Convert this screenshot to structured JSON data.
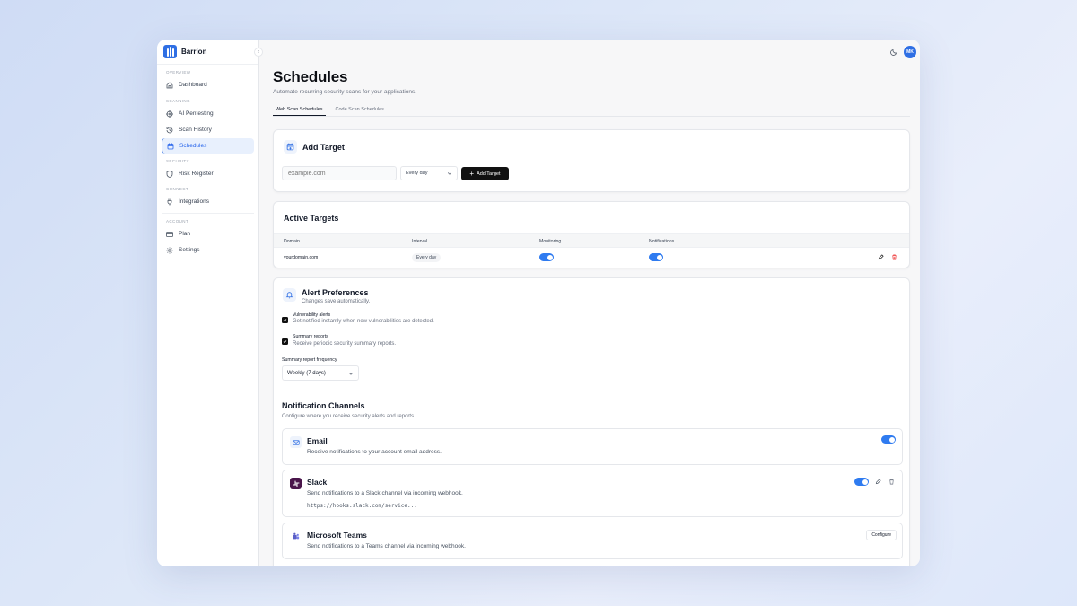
{
  "app": {
    "name": "Barrion",
    "user_initials": "MK"
  },
  "sidebar": {
    "sections": [
      {
        "label": "OVERVIEW",
        "items": [
          {
            "label": "Dashboard",
            "icon": "home-icon"
          }
        ]
      },
      {
        "label": "SCANNING",
        "items": [
          {
            "label": "AI Pentesting",
            "icon": "target-icon"
          },
          {
            "label": "Scan History",
            "icon": "history-icon"
          },
          {
            "label": "Schedules",
            "icon": "calendar-icon",
            "active": true
          }
        ]
      },
      {
        "label": "SECURITY",
        "items": [
          {
            "label": "Risk Register",
            "icon": "shield-icon"
          }
        ]
      },
      {
        "label": "CONNECT",
        "items": [
          {
            "label": "Integrations",
            "icon": "plug-icon"
          }
        ]
      },
      {
        "label": "ACCOUNT",
        "items": [
          {
            "label": "Plan",
            "icon": "card-icon"
          },
          {
            "label": "Settings",
            "icon": "gear-icon"
          }
        ]
      }
    ]
  },
  "page": {
    "title": "Schedules",
    "subtitle": "Automate recurring security scans for your applications.",
    "tabs": [
      {
        "label": "Web Scan Schedules",
        "active": true
      },
      {
        "label": "Code Scan Schedules",
        "active": false
      }
    ]
  },
  "add_target": {
    "title": "Add Target",
    "domain_placeholder": "example.com",
    "interval_value": "Every day",
    "button_label": "Add Target"
  },
  "active_targets": {
    "title": "Active Targets",
    "columns": [
      "Domain",
      "Interval",
      "Monitoring",
      "Notifications"
    ],
    "rows": [
      {
        "domain": "yourdomain.com",
        "interval": "Every day",
        "monitoring": true,
        "notifications": true
      }
    ]
  },
  "alerts": {
    "title": "Alert Preferences",
    "subtitle": "Changes save automatically.",
    "options": [
      {
        "title": "Vulnerability alerts",
        "desc": "Get notified instantly when new vulnerabilities are detected.",
        "checked": true
      },
      {
        "title": "Summary reports",
        "desc": "Receive periodic security summary reports.",
        "checked": true
      }
    ],
    "frequency_label": "Summary report frequency",
    "frequency_value": "Weekly (7 days)"
  },
  "channels": {
    "title": "Notification Channels",
    "subtitle": "Configure where you receive security alerts and reports.",
    "items": [
      {
        "name": "Email",
        "desc": "Receive notifications to your account email address.",
        "enabled": true
      },
      {
        "name": "Slack",
        "desc": "Send notifications to a Slack channel via incoming webhook.",
        "url": "https://hooks.slack.com/service...",
        "enabled": true
      },
      {
        "name": "Microsoft Teams",
        "desc": "Send notifications to a Teams channel via incoming webhook.",
        "button": "Configure"
      }
    ]
  },
  "colors": {
    "accent": "#2f6fe4",
    "toggle_on": "#2f7bf0",
    "danger": "#ef4444",
    "slack": "#4a154b",
    "teams": "#5b5fc7"
  }
}
